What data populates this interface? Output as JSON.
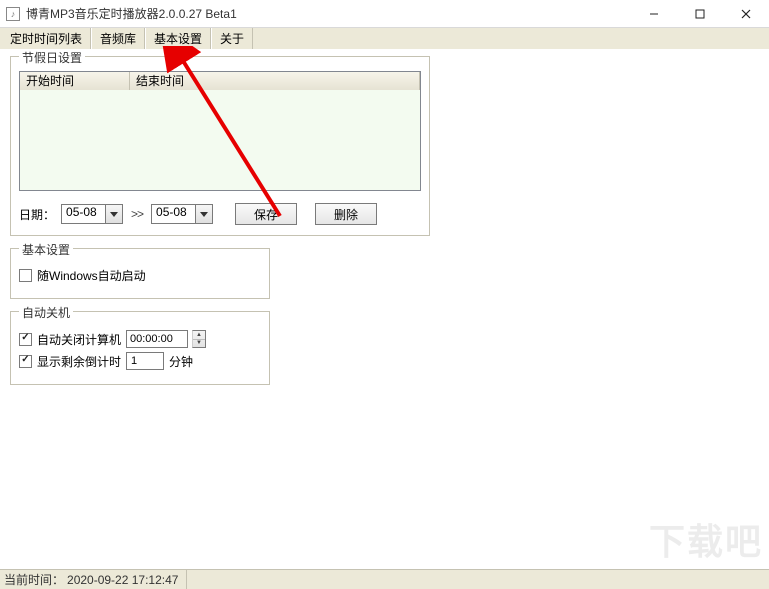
{
  "window": {
    "title": "博青MP3音乐定时播放器2.0.0.27 Beta1"
  },
  "menu": {
    "items": [
      "定时时间列表",
      "音频库",
      "基本设置",
      "关于"
    ]
  },
  "holiday": {
    "legend": "节假日设置",
    "col_start": "开始时间",
    "col_end": "结束时间",
    "date_label": "日期：",
    "date_from": "05-08",
    "date_to": "05-08",
    "to_symbol": ">>",
    "save_btn": "保存",
    "delete_btn": "删除"
  },
  "basic": {
    "legend": "基本设置",
    "autostart_label": "随Windows自动启动",
    "autostart_checked": false
  },
  "shutdown": {
    "legend": "自动关机",
    "autoshut_label": "自动关闭计算机",
    "autoshut_checked": true,
    "autoshut_time": "00:00:00",
    "showcountdown_label": "显示剩余倒计时",
    "showcountdown_checked": true,
    "countdown_value": "1",
    "countdown_unit": "分钟"
  },
  "status": {
    "time_label": "当前时间：",
    "time_value": "2020-09-22 17:12:47"
  },
  "watermark": "下载吧"
}
